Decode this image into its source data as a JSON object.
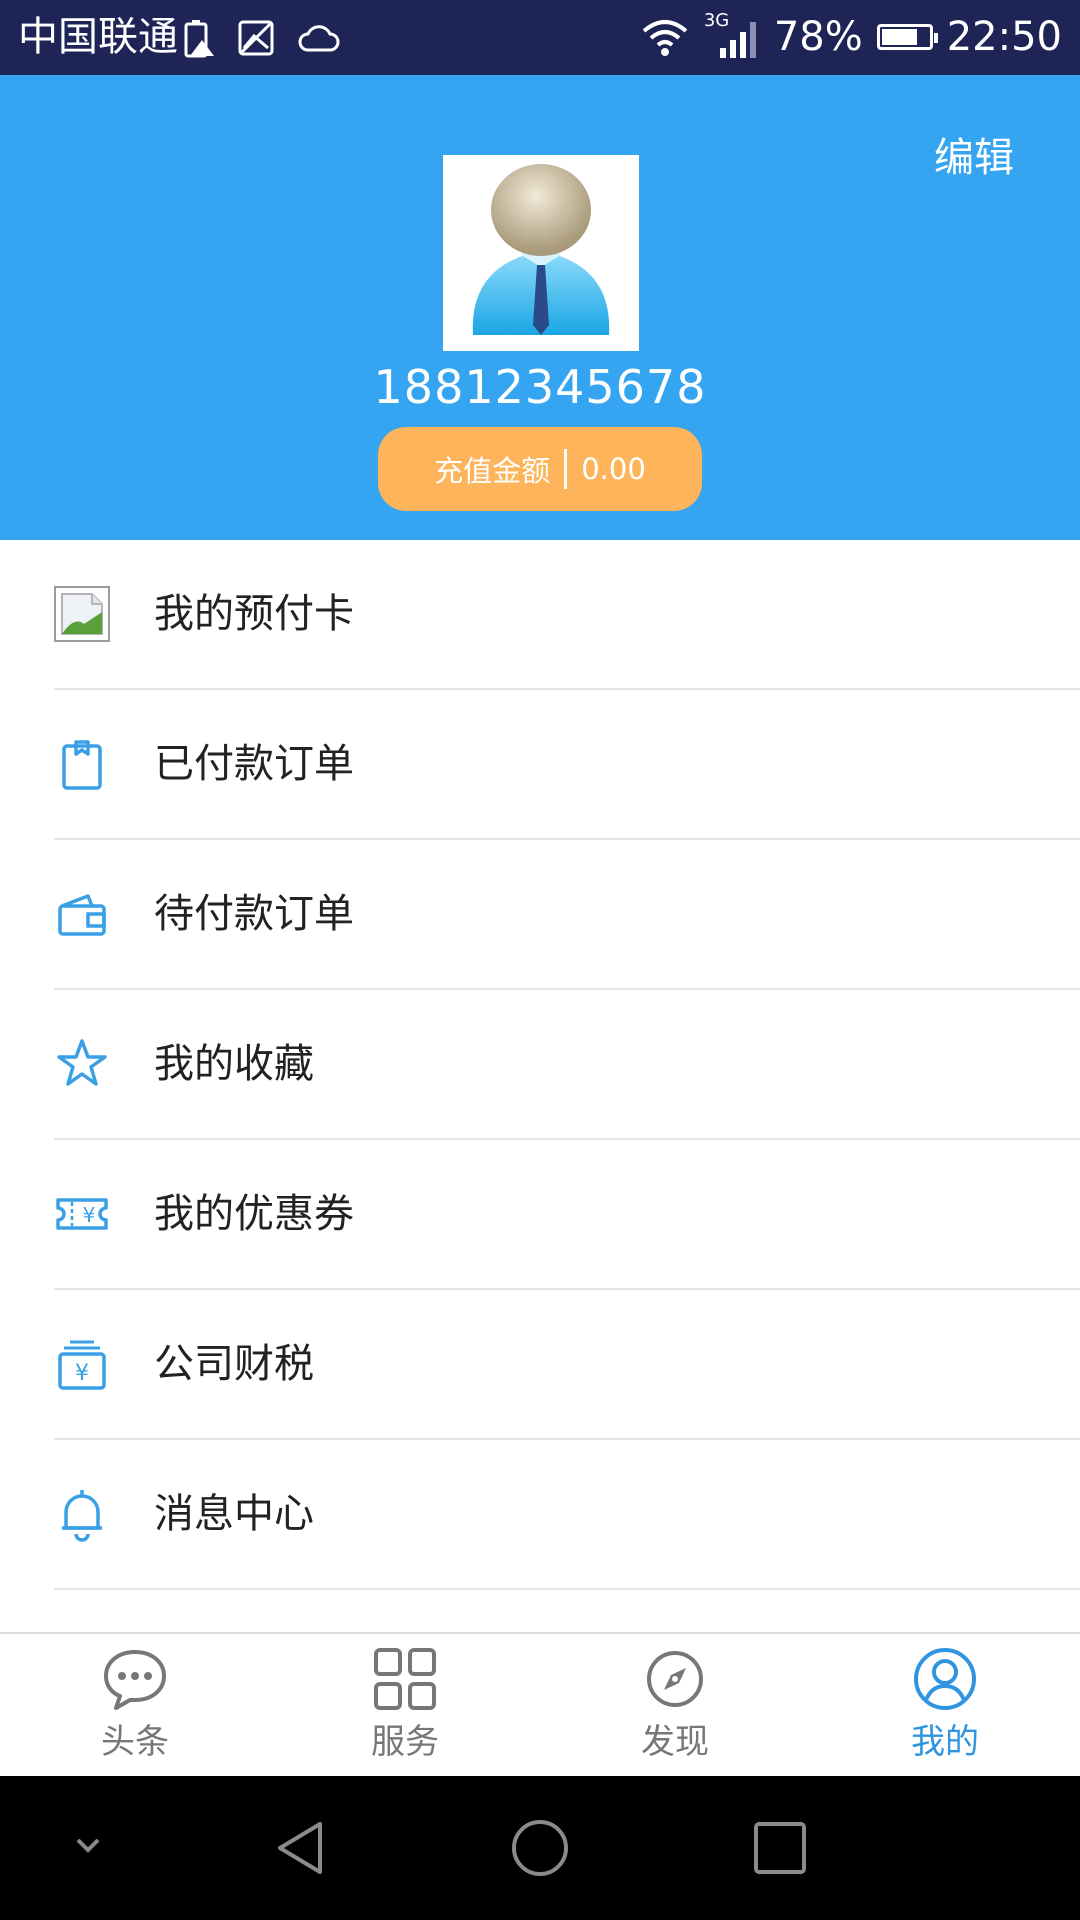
{
  "status_bar": {
    "carrier": "中国联通",
    "network": "3G",
    "battery": "78%",
    "battery_level": 0.78,
    "time": "22:50"
  },
  "profile": {
    "edit_label": "编辑",
    "phone": "18812345678",
    "balance_label": "充值金额",
    "balance_value": "0.00"
  },
  "menu": [
    {
      "label": "我的预付卡",
      "icon": "broken-image-icon"
    },
    {
      "label": "已付款订单",
      "icon": "clipboard-icon"
    },
    {
      "label": "待付款订单",
      "icon": "wallet-icon"
    },
    {
      "label": "我的收藏",
      "icon": "star-icon"
    },
    {
      "label": "我的优惠券",
      "icon": "coupon-icon"
    },
    {
      "label": "公司财税",
      "icon": "finance-icon"
    },
    {
      "label": "消息中心",
      "icon": "bell-icon"
    }
  ],
  "tabs": [
    {
      "label": "头条",
      "icon": "chat-bubble-icon",
      "active": false
    },
    {
      "label": "服务",
      "icon": "grid-icon",
      "active": false
    },
    {
      "label": "发现",
      "icon": "compass-icon",
      "active": false
    },
    {
      "label": "我的",
      "icon": "user-circle-icon",
      "active": true
    }
  ],
  "colors": {
    "header_bg": "#35a5f1",
    "status_bg": "#1f2457",
    "balance_bg": "#fdb45a",
    "accent": "#2f95e0",
    "icon_blue": "#3aa0e6"
  }
}
